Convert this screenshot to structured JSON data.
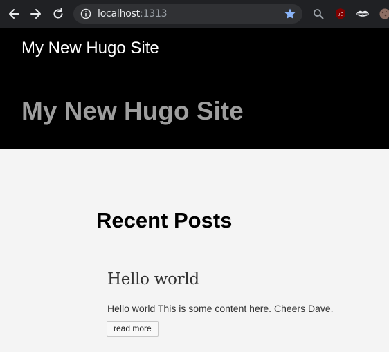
{
  "browser": {
    "url_host": "localhost",
    "url_port": ":1313",
    "icons": [
      "back-arrow-icon",
      "forward-arrow-icon",
      "reload-icon",
      "info-icon",
      "bookmark-star-icon",
      "search-extension-icon",
      "ublock-origin-icon",
      "lips-extension-icon",
      "cookie-extension-icon"
    ],
    "star_color": "#8ab4f8"
  },
  "site": {
    "brand": "My New Hugo Site",
    "hero_title": "My New Hugo Site",
    "header_bg": "#000000"
  },
  "main": {
    "section_title": "Recent Posts",
    "posts": [
      {
        "title": "Hello world",
        "summary": "Hello world This is some content here. Cheers Dave.",
        "read_more_label": "read more"
      }
    ]
  }
}
